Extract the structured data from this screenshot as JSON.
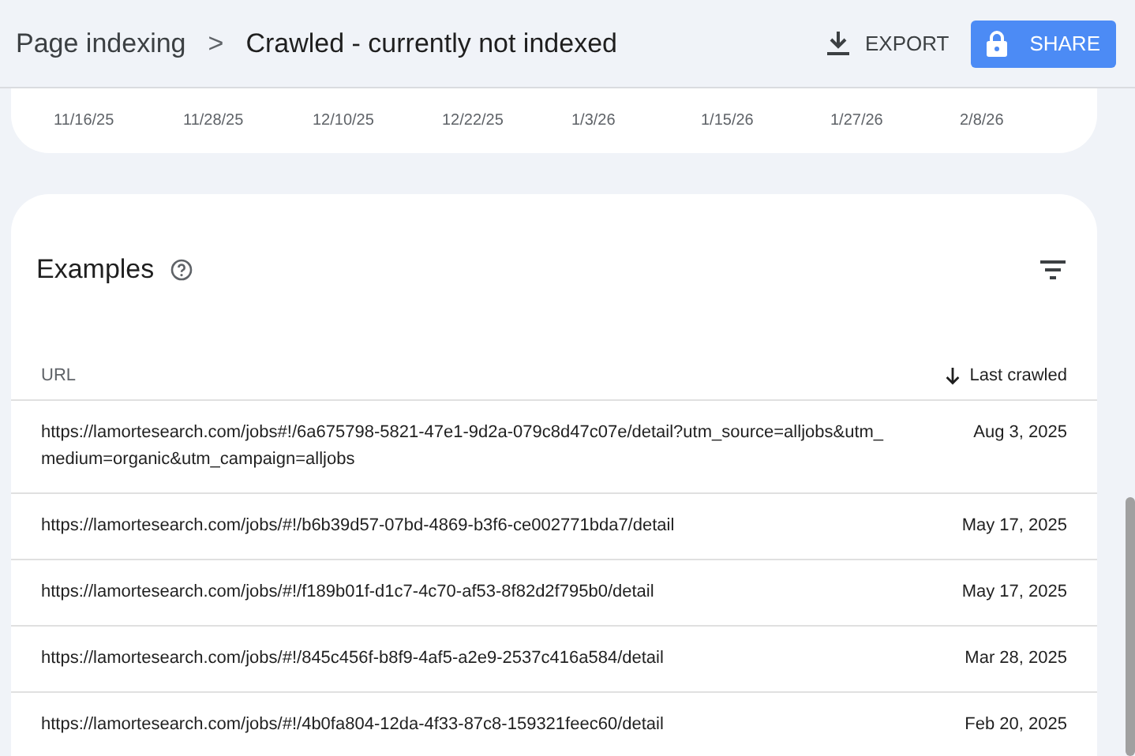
{
  "breadcrumb": {
    "parent": "Page indexing",
    "separator": ">",
    "current": "Crawled - currently not indexed"
  },
  "actions": {
    "export": "EXPORT",
    "share": "SHARE"
  },
  "chart_axis": {
    "labels": [
      "11/16/25",
      "11/28/25",
      "12/10/25",
      "12/22/25",
      "1/3/26",
      "1/15/26",
      "1/27/26",
      "2/8/26"
    ]
  },
  "examples": {
    "title": "Examples",
    "columns": [
      {
        "label": "URL",
        "sorted": false
      },
      {
        "label": "Last crawled",
        "sorted": true
      }
    ],
    "rows": [
      {
        "url": "https://lamortesearch.com/jobs#!/6a675798-5821-47e1-9d2a-079c8d47c07e/detail?utm_source=alljobs&utm_medium=organic&utm_campaign=alljobs",
        "date": "Aug 3, 2025"
      },
      {
        "url": "https://lamortesearch.com/jobs/#!/b6b39d57-07bd-4869-b3f6-ce002771bda7/detail",
        "date": "May 17, 2025"
      },
      {
        "url": "https://lamortesearch.com/jobs/#!/f189b01f-d1c7-4c70-af53-8f82d2f795b0/detail",
        "date": "May 17, 2025"
      },
      {
        "url": "https://lamortesearch.com/jobs/#!/845c456f-b8f9-4af5-a2e9-2537c416a584/detail",
        "date": "Mar 28, 2025"
      },
      {
        "url": "https://lamortesearch.com/jobs/#!/4b0fa804-12da-4f33-87c8-159321feec60/detail",
        "date": "Feb 20, 2025"
      }
    ]
  }
}
